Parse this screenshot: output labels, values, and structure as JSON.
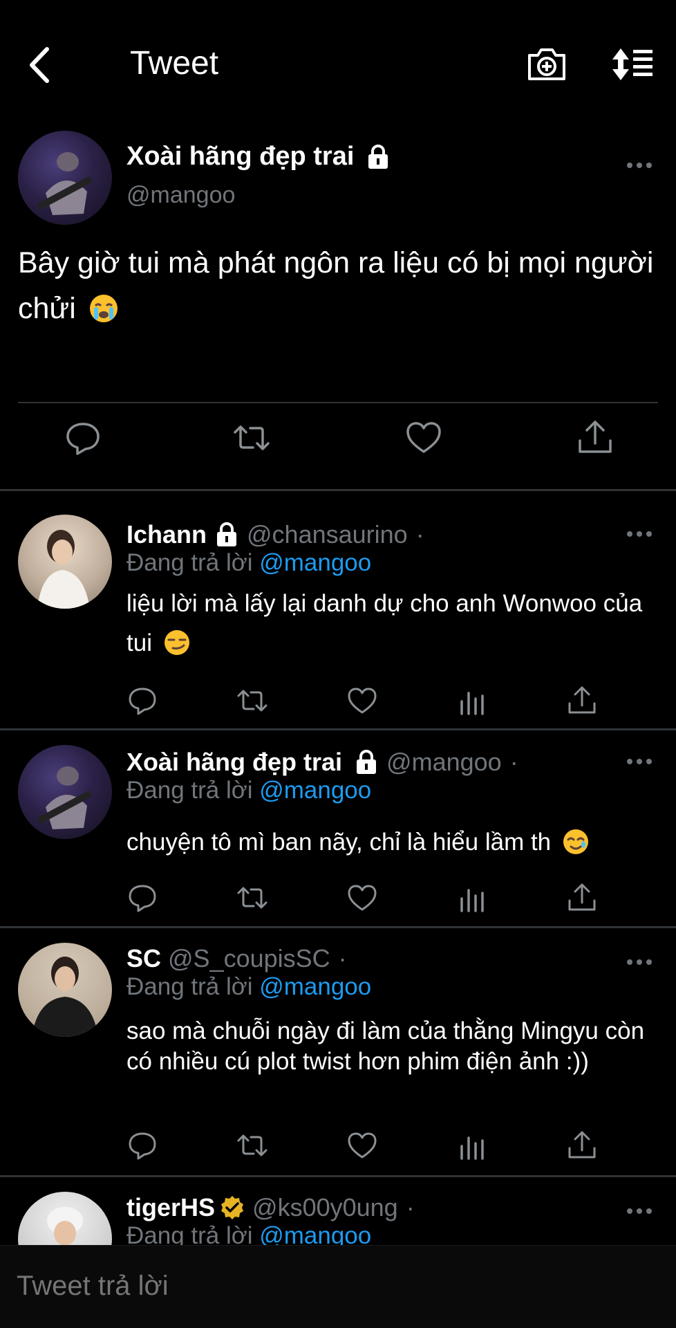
{
  "header": {
    "title": "Tweet"
  },
  "main_tweet": {
    "name": "Xoài hãng đẹp trai",
    "handle": "@mangoo",
    "text": "Bây giờ tui mà phát ngôn ra liệu có bị mọi người chửi"
  },
  "replies": [
    {
      "name": "Ichann",
      "handle": "@chansaurino",
      "dot": "·",
      "replying_prefix": "Đang trả lời",
      "replying_to": "@mangoo",
      "text": "liệu lời mà lấy lại danh dự cho anh Wonwoo của tui"
    },
    {
      "name": "Xoài hãng đẹp trai",
      "handle": "@mangoo",
      "dot": "·",
      "replying_prefix": "Đang trả lời",
      "replying_to": "@mangoo",
      "text": "chuyện tô mì ban nãy, chỉ là hiểu lầm th"
    },
    {
      "name": "SC",
      "handle": "@S_coupisSC",
      "dot": "·",
      "replying_prefix": "Đang trả lời",
      "replying_to": "@mangoo",
      "text": "sao mà chuỗi ngày đi làm của thằng Mingyu còn có nhiều cú plot twist hơn phim điện ảnh :))"
    },
    {
      "name": "tigerHS",
      "handle": "@ks00y0ung",
      "dot": "·",
      "replying_prefix": "Đang trả lời",
      "replying_to": "@mangoo"
    }
  ],
  "composer": {
    "placeholder": "Tweet trả lời"
  },
  "colors": {
    "background": "#000000",
    "accent": "#1d9bf0",
    "muted": "#71767b",
    "divider": "#2f3336"
  },
  "icons": [
    "back-icon",
    "add-photo-icon",
    "sort-icon",
    "lock-icon",
    "verified-icon",
    "more-icon",
    "reply-icon",
    "retweet-icon",
    "like-icon",
    "analytics-icon",
    "share-icon"
  ]
}
